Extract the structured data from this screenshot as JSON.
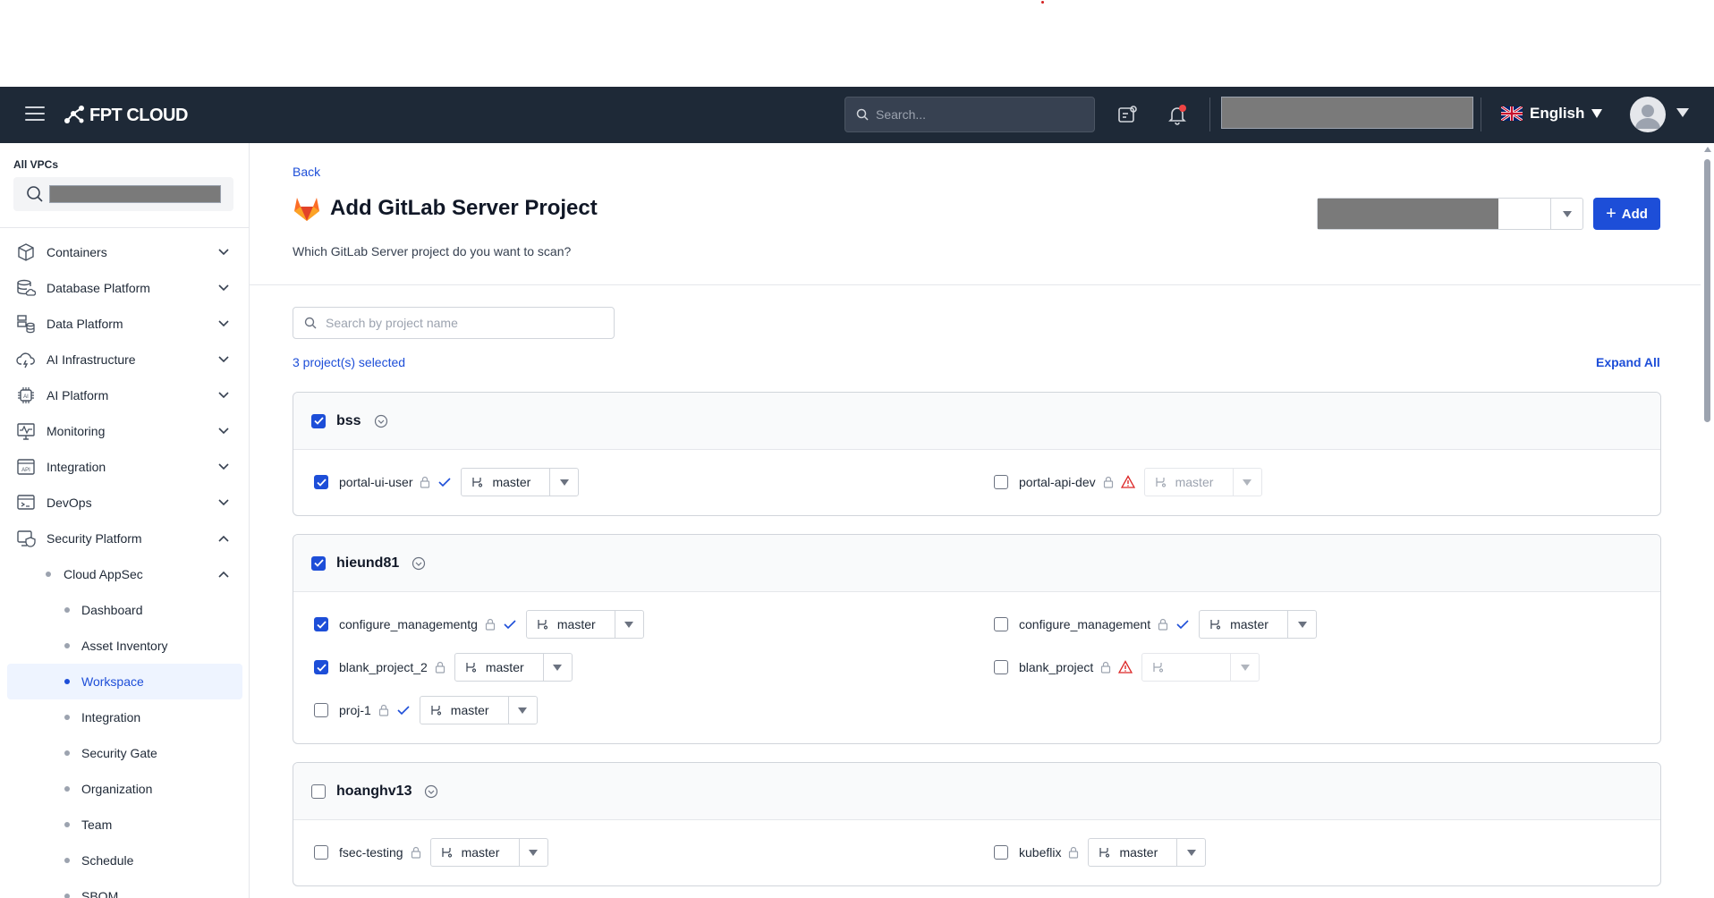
{
  "header": {
    "brand": "FPT CLOUD",
    "search_placeholder": "Search...",
    "language": "English"
  },
  "sidebar": {
    "vpc_label": "All VPCs",
    "items": [
      {
        "label": "Containers",
        "icon": "cube-icon"
      },
      {
        "label": "Database Platform",
        "icon": "database-cloud-icon"
      },
      {
        "label": "Data Platform",
        "icon": "data-stack-icon"
      },
      {
        "label": "AI Infrastructure",
        "icon": "cloud-bolt-icon"
      },
      {
        "label": "AI Platform",
        "icon": "ai-chip-icon"
      },
      {
        "label": "Monitoring",
        "icon": "monitor-pulse-icon"
      },
      {
        "label": "Integration",
        "icon": "api-icon"
      },
      {
        "label": "DevOps",
        "icon": "devops-window-icon"
      },
      {
        "label": "Security Platform",
        "icon": "shield-monitor-icon"
      }
    ],
    "cloud_appsec": "Cloud AppSec",
    "sub_items": [
      "Dashboard",
      "Asset Inventory",
      "Workspace",
      "Integration",
      "Security Gate",
      "Organization",
      "Team",
      "Schedule",
      "SBOM"
    ],
    "active": "Workspace"
  },
  "main": {
    "back": "Back",
    "title": "Add GitLab Server Project",
    "subtitle": "Which GitLab Server project do you want to scan?",
    "add_label": "Add",
    "search_placeholder": "Search by project name",
    "selected_count": "3 project(s) selected",
    "expand_all": "Expand All",
    "groups": [
      {
        "name": "bss",
        "checked": true,
        "projects": [
          {
            "name": "portal-ui-user",
            "checked": true,
            "status": "ok",
            "branch": "master"
          },
          {
            "name": "portal-api-dev",
            "checked": false,
            "status": "warning",
            "branch": "master"
          }
        ]
      },
      {
        "name": "hieund81",
        "checked": true,
        "projects": [
          {
            "name": "configure_managementg",
            "checked": true,
            "status": "ok",
            "branch": "master"
          },
          {
            "name": "configure_management",
            "checked": false,
            "status": "ok",
            "branch": "master"
          },
          {
            "name": "blank_project_2",
            "checked": true,
            "status": "none",
            "branch": "master"
          },
          {
            "name": "blank_project",
            "checked": false,
            "status": "warning",
            "branch": ""
          },
          {
            "name": "proj-1",
            "checked": false,
            "status": "ok",
            "branch": "master"
          }
        ]
      },
      {
        "name": "hoanghv13",
        "checked": false,
        "projects": [
          {
            "name": "fsec-testing",
            "checked": false,
            "status": "none",
            "branch": "master"
          },
          {
            "name": "kubeflix",
            "checked": false,
            "status": "none",
            "branch": "master"
          }
        ]
      }
    ]
  },
  "colors": {
    "header_bg": "#1e2937",
    "accent": "#1d4ed8",
    "warning": "#dc2626"
  }
}
